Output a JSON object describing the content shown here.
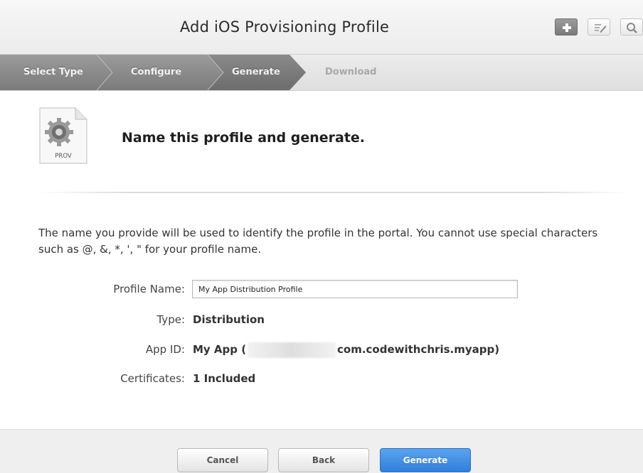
{
  "header": {
    "title": "Add iOS Provisioning Profile",
    "tools": [
      {
        "icon": "plus-icon"
      },
      {
        "icon": "edit-icon"
      },
      {
        "icon": "search-icon"
      }
    ]
  },
  "steps": [
    {
      "label": "Select Type",
      "state": "done"
    },
    {
      "label": "Configure",
      "state": "done"
    },
    {
      "label": "Generate",
      "state": "current"
    },
    {
      "label": "Download",
      "state": "upcoming"
    }
  ],
  "section": {
    "icon_label": "PROV",
    "heading": "Name this profile and generate."
  },
  "intro_text": "The name you provide will be used to identify the profile in the portal. You cannot use special characters such as @, &, *, ', \" for your profile name.",
  "form": {
    "profile_name_label": "Profile Name:",
    "profile_name_value": "My App Distribution Profile",
    "type_label": "Type:",
    "type_value": "Distribution",
    "app_id_label": "App ID:",
    "app_id_prefix": "My App (",
    "app_id_suffix": "com.codewithchris.myapp)",
    "certificates_label": "Certificates:",
    "certificates_value": "1 Included"
  },
  "footer": {
    "cancel_label": "Cancel",
    "back_label": "Back",
    "generate_label": "Generate"
  },
  "colors": {
    "primary_button": "#3a8ae0",
    "step_done": "#8a8a8a",
    "step_current": "#7a7a7a"
  }
}
